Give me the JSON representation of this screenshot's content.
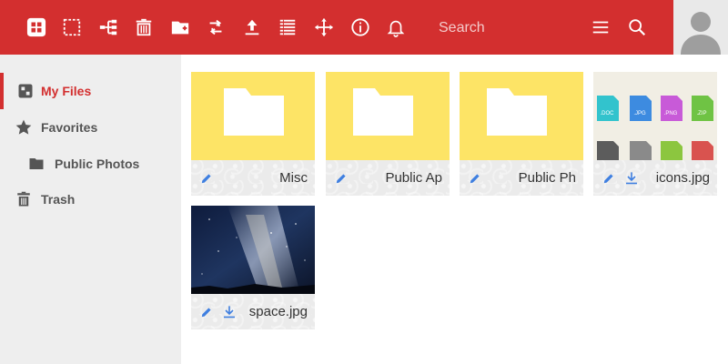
{
  "colors": {
    "accent": "#d32f2f",
    "folder": "#fde466",
    "sidebar_bg": "#eeeeee",
    "icon_blue": "#3f7fe0"
  },
  "toolbar": {
    "icons": [
      "logo-icon",
      "select-icon",
      "tree-icon",
      "delete-icon",
      "new-folder-icon",
      "sync-icon",
      "upload-icon",
      "list-view-icon",
      "move-icon",
      "info-icon",
      "notifications-icon"
    ],
    "search_placeholder": "Search",
    "menu_icon": "menu-icon",
    "search_icon": "search-icon"
  },
  "sidebar": {
    "items": [
      {
        "label": "My Files",
        "icon": "my-files-icon",
        "active": true
      },
      {
        "label": "Favorites",
        "icon": "star-icon",
        "active": false
      },
      {
        "label": "Public Photos",
        "icon": "folder-icon",
        "active": false
      },
      {
        "label": "Trash",
        "icon": "trash-icon",
        "active": false
      }
    ]
  },
  "files": [
    {
      "name": "Misc",
      "type": "folder"
    },
    {
      "name": "Public Ap",
      "type": "folder"
    },
    {
      "name": "Public Ph",
      "type": "folder"
    },
    {
      "name": "icons.jpg",
      "type": "image",
      "icon_labels": [
        ".DOC",
        ".JPG",
        ".PNG",
        ".ZIP"
      ]
    },
    {
      "name": "space.jpg",
      "type": "image"
    }
  ]
}
